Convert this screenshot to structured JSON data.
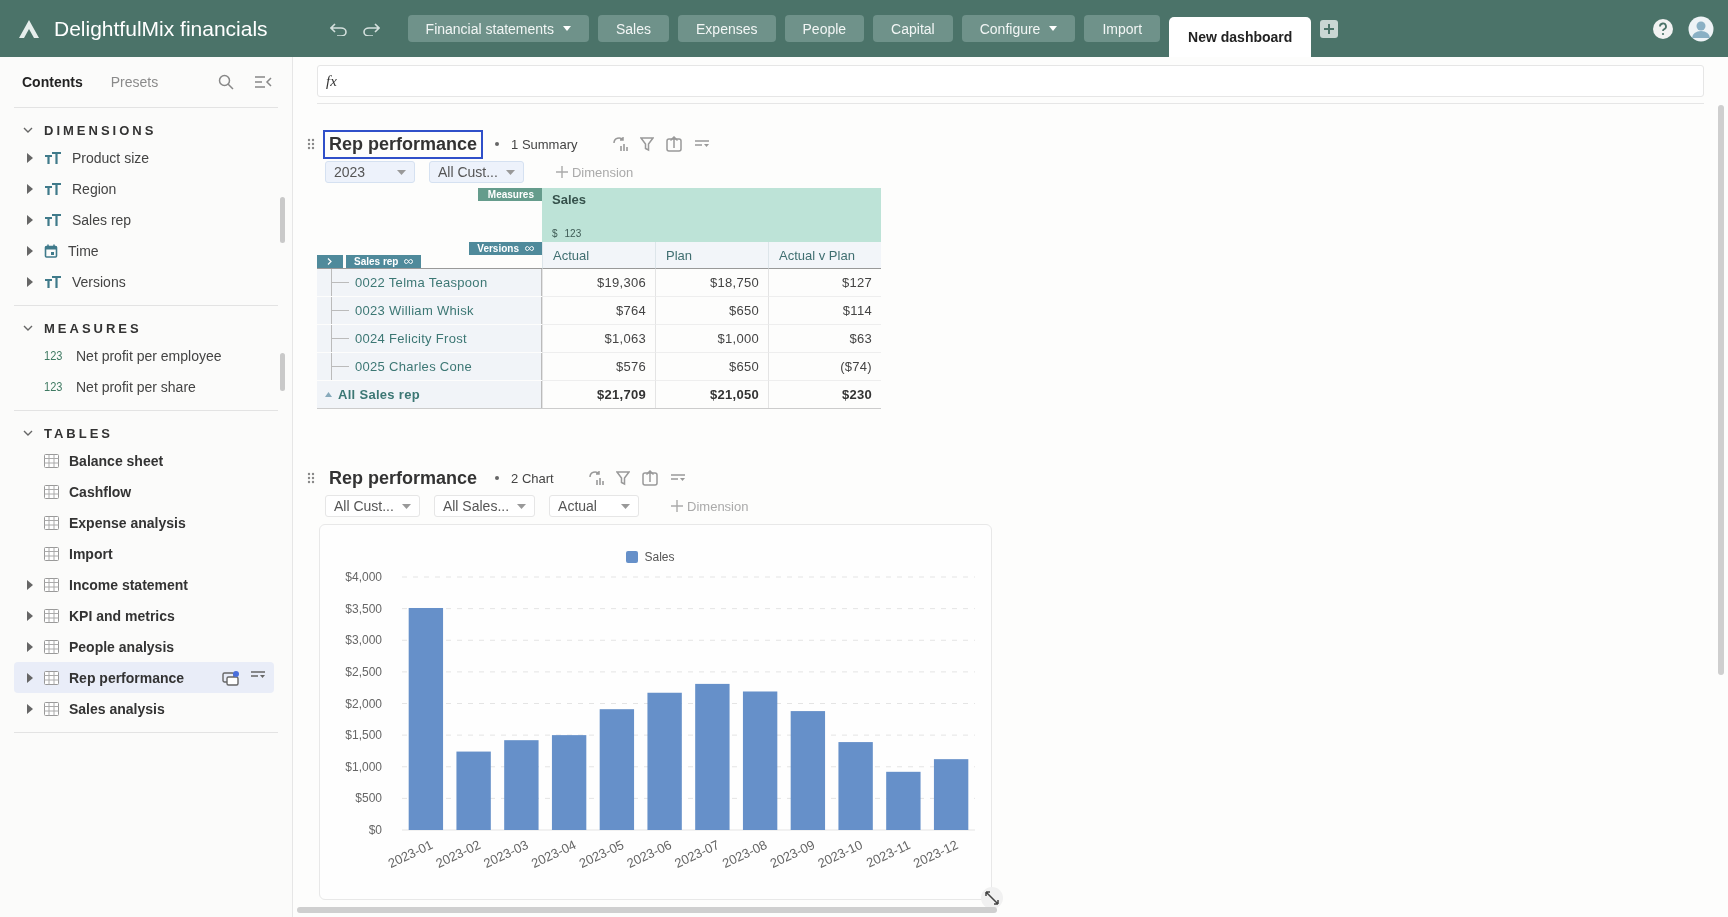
{
  "app": {
    "title": "DelightfulMix financials"
  },
  "nav_tabs": [
    {
      "label": "Financial statements",
      "dropdown": true,
      "selected": false
    },
    {
      "label": "Sales",
      "dropdown": false,
      "selected": false
    },
    {
      "label": "Expenses",
      "dropdown": false,
      "selected": false
    },
    {
      "label": "People",
      "dropdown": false,
      "selected": false
    },
    {
      "label": "Capital",
      "dropdown": false,
      "selected": false
    },
    {
      "label": "Configure",
      "dropdown": true,
      "selected": false
    },
    {
      "label": "Import",
      "dropdown": false,
      "selected": false
    },
    {
      "label": "New dashboard",
      "dropdown": false,
      "selected": true
    }
  ],
  "sidebar": {
    "tabs": [
      {
        "label": "Contents",
        "selected": true
      },
      {
        "label": "Presets",
        "selected": false
      }
    ],
    "sections": [
      {
        "title": "DIMENSIONS",
        "expanded": true,
        "items": [
          {
            "label": "Product size",
            "kind": "text",
            "expandable": true,
            "selected": false
          },
          {
            "label": "Region",
            "kind": "text",
            "expandable": true,
            "selected": false
          },
          {
            "label": "Sales rep",
            "kind": "text",
            "expandable": true,
            "selected": false
          },
          {
            "label": "Time",
            "kind": "time",
            "expandable": true,
            "selected": false
          },
          {
            "label": "Versions",
            "kind": "text",
            "expandable": true,
            "selected": false
          }
        ]
      },
      {
        "title": "MEASURES",
        "expanded": true,
        "items": [
          {
            "label": "Net profit per employee",
            "kind": "measure",
            "badge": "123",
            "expandable": false,
            "selected": false
          },
          {
            "label": "Net profit per share",
            "kind": "measure",
            "badge": "123",
            "expandable": false,
            "selected": false
          }
        ]
      },
      {
        "title": "TABLES",
        "expanded": true,
        "items": [
          {
            "label": "Balance sheet",
            "kind": "table",
            "expandable": false,
            "selected": false
          },
          {
            "label": "Cashflow",
            "kind": "table",
            "expandable": false,
            "selected": false
          },
          {
            "label": "Expense analysis",
            "kind": "table",
            "expandable": false,
            "selected": false
          },
          {
            "label": "Import",
            "kind": "table",
            "expandable": false,
            "selected": false
          },
          {
            "label": "Income statement",
            "kind": "table",
            "expandable": true,
            "selected": false
          },
          {
            "label": "KPI and metrics",
            "kind": "table",
            "expandable": true,
            "selected": false
          },
          {
            "label": "People analysis",
            "kind": "table",
            "expandable": true,
            "selected": false
          },
          {
            "label": "Rep performance",
            "kind": "table",
            "expandable": true,
            "selected": true
          },
          {
            "label": "Sales analysis",
            "kind": "table",
            "expandable": true,
            "selected": false
          }
        ]
      }
    ]
  },
  "formula_bar": {
    "label": "fx"
  },
  "widgets": [
    {
      "kind": "summary",
      "title": "Rep performance",
      "title_focused": true,
      "subtitle": "1 Summary",
      "filters": [
        {
          "label": "2023",
          "highlighted": true
        },
        {
          "label": "All Cust...",
          "highlighted": true
        }
      ],
      "add_label": "Dimension",
      "table": {
        "measures_label": "Measures",
        "measure": "Sales",
        "measure_unit": "$",
        "measure_badge": "123",
        "versions_label": "Versions",
        "rows_label": "Sales rep",
        "columns": [
          "Actual",
          "Plan",
          "Actual v Plan"
        ],
        "rows": [
          {
            "label": "0022 Telma Teaspoon",
            "values": [
              "$19,306",
              "$18,750",
              "$127"
            ]
          },
          {
            "label": "0023 William Whisk",
            "values": [
              "$764",
              "$650",
              "$114"
            ]
          },
          {
            "label": "0024 Felicity Frost",
            "values": [
              "$1,063",
              "$1,000",
              "$63"
            ]
          },
          {
            "label": "0025 Charles Cone",
            "values": [
              "$576",
              "$650",
              "($74)"
            ]
          }
        ],
        "total": {
          "label": "All Sales rep",
          "values": [
            "$21,709",
            "$21,050",
            "$230"
          ]
        }
      }
    },
    {
      "kind": "chart",
      "title": "Rep performance",
      "title_focused": false,
      "subtitle": "2 Chart",
      "filters": [
        {
          "label": "All Cust...",
          "highlighted": false
        },
        {
          "label": "All Sales...",
          "highlighted": false
        },
        {
          "label": "Actual",
          "highlighted": false
        }
      ],
      "add_label": "Dimension",
      "chart_data": {
        "type": "bar",
        "categories": [
          "2023-01",
          "2023-02",
          "2023-03",
          "2023-04",
          "2023-05",
          "2023-06",
          "2023-07",
          "2023-08",
          "2023-09",
          "2023-10",
          "2023-11",
          "2023-12"
        ],
        "series": [
          {
            "name": "Sales",
            "color": "#6690c9",
            "values": [
              3510,
              1240,
              1420,
              1500,
              1910,
              2170,
              2310,
              2190,
              1880,
              1390,
              920,
              1120
            ]
          }
        ],
        "ylim": [
          0,
          4000
        ],
        "grid": true,
        "yticks": [
          {
            "value": 0,
            "label": "$0"
          },
          {
            "value": 500,
            "label": "$500"
          },
          {
            "value": 1000,
            "label": "$1,000"
          },
          {
            "value": 1500,
            "label": "$1,500"
          },
          {
            "value": 2000,
            "label": "$2,000"
          },
          {
            "value": 2500,
            "label": "$2,500"
          },
          {
            "value": 3000,
            "label": "$3,000"
          },
          {
            "value": 3500,
            "label": "$3,500"
          },
          {
            "value": 4000,
            "label": "$4,000"
          }
        ]
      }
    }
  ]
}
